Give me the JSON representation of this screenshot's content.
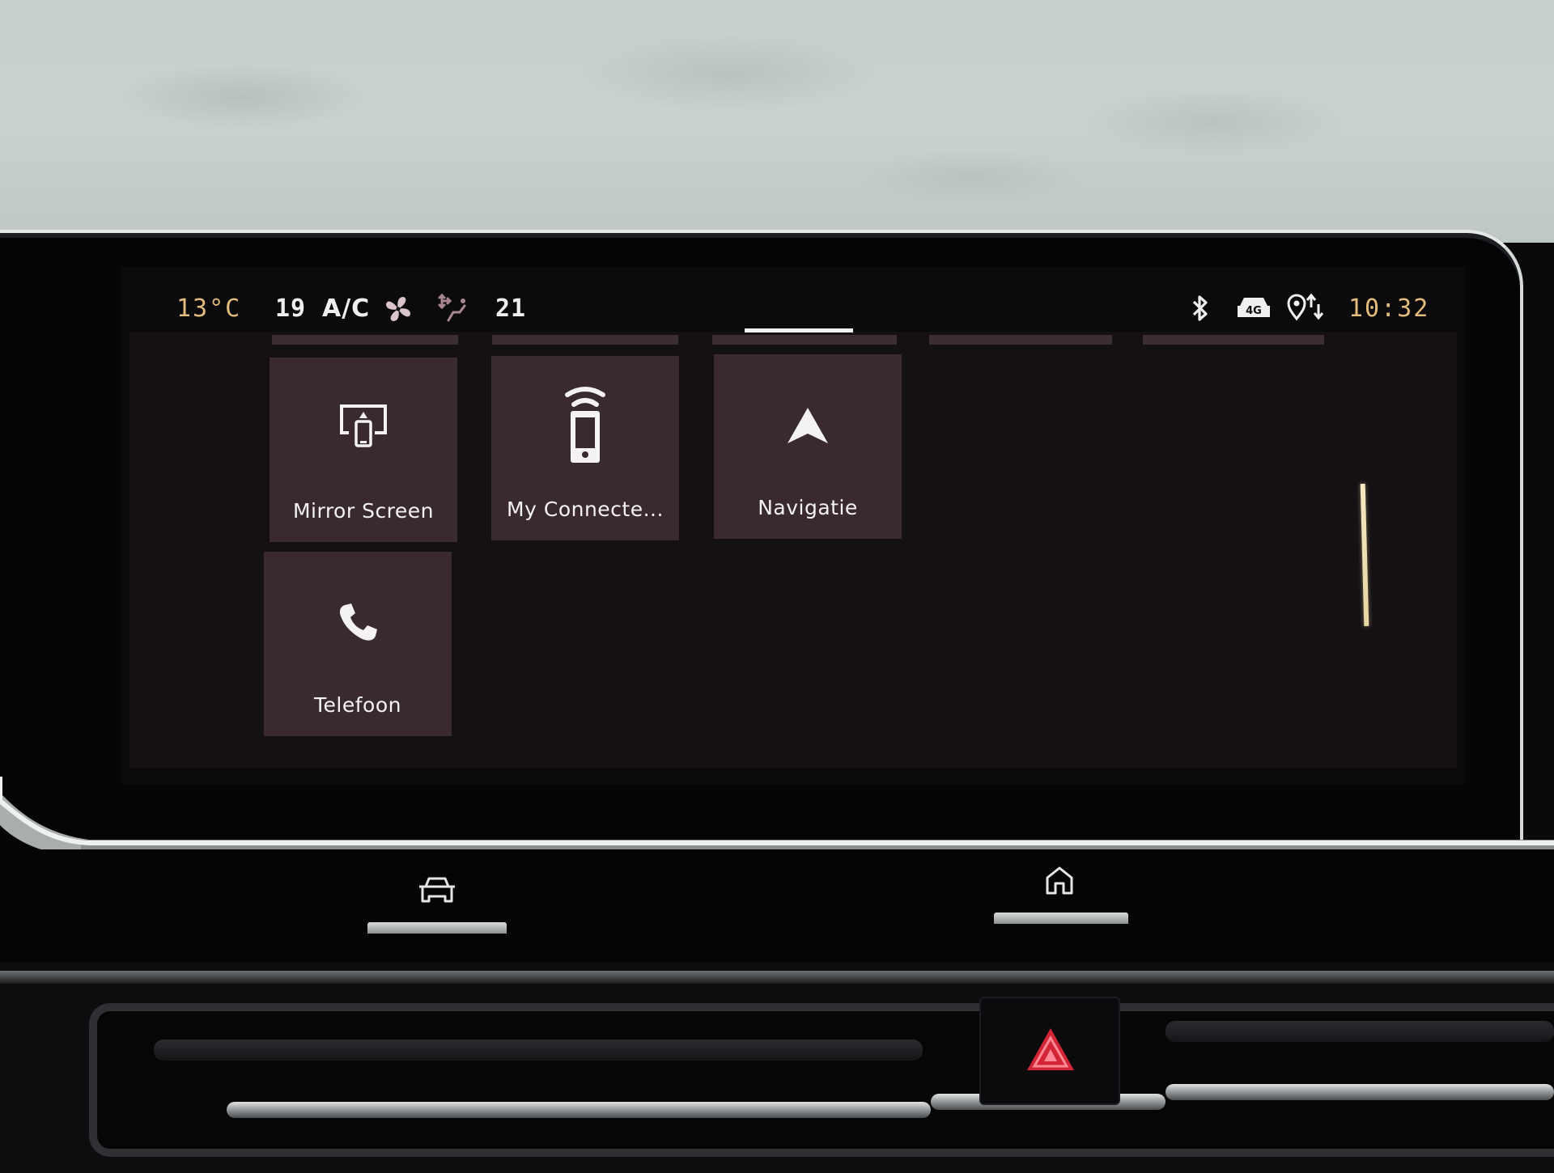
{
  "status_bar": {
    "outside_temperature": "13°C",
    "driver_temperature": "19",
    "ac_label": "A/C",
    "fan_icon": "fan-icon",
    "air_distribution_icon": "seat-airflow-icon",
    "passenger_temperature": "21",
    "bluetooth_icon": "bluetooth-icon",
    "network_icon": "car-4g-icon",
    "network_label": "4G",
    "location_icon": "location-data-sharing-icon",
    "clock": "10:32"
  },
  "pages": {
    "count": 5,
    "active_index": 2
  },
  "tiles": [
    {
      "label": "Mirror Screen",
      "icon": "mirror-screen-icon"
    },
    {
      "label": "My Connecte...",
      "icon": "connected-phone-icon"
    },
    {
      "label": "Navigatie",
      "icon": "navigation-arrow-icon"
    },
    {
      "label": "Telefoon",
      "icon": "phone-icon"
    }
  ],
  "hardware_buttons": {
    "vehicle_icon": "car-icon",
    "home_icon": "home-icon",
    "hazard_icon": "hazard-warning-icon"
  },
  "colors": {
    "accent_amber": "#e2bc7c",
    "tile_background": "#382a2e",
    "hazard_red": "#e8283a"
  }
}
